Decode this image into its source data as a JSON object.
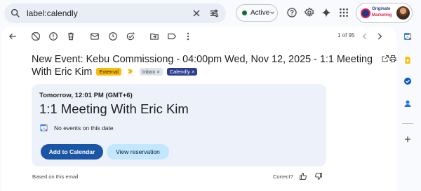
{
  "search": {
    "query": "label:calendly"
  },
  "status": {
    "label": "Active",
    "color": "#146c2e"
  },
  "account": {
    "logo_line1": "Originate",
    "logo_line2": "Marketing"
  },
  "toolbar": {
    "pager": "1 of 95"
  },
  "email": {
    "subject": "New Event: Kebu Commissiong - 04:00pm Wed, Nov 12, 2025 - 1:1 Meeting With Eric Kim",
    "labels": {
      "external": "External",
      "inbox": "Inbox",
      "calendly": "Calendly"
    }
  },
  "event_card": {
    "when": "Tomorrow, 12:01 PM (GMT+6)",
    "title": "1:1 Meeting With Eric Kim",
    "calendar_status": "No events on this date",
    "add_button": "Add to Calendar",
    "view_button": "View reservation"
  },
  "footer": {
    "based_on": "Based on this email",
    "correct": "Correct?"
  },
  "icons": [
    "search-icon",
    "clear-icon",
    "filter-icon",
    "chevron-down-icon",
    "help-icon",
    "settings-icon",
    "gemini-icon",
    "apps-icon",
    "back-icon",
    "not-spam-icon",
    "report-icon",
    "delete-icon",
    "mark-unread-icon",
    "snooze-icon",
    "add-task-icon",
    "move-to-icon",
    "label-icon",
    "more-icon",
    "prev-icon",
    "next-icon",
    "print-icon",
    "open-new-window-icon",
    "google-calendar-icon",
    "thumbs-up-icon",
    "thumbs-down-icon",
    "calendar-icon",
    "keep-icon",
    "tasks-icon",
    "contacts-icon",
    "add-icon"
  ]
}
